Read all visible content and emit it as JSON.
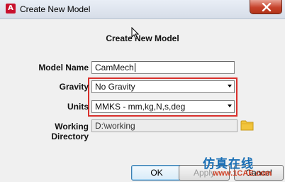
{
  "window": {
    "title": "Create New Model",
    "app_icon_letter": "A"
  },
  "dialog": {
    "heading": "Create New Model",
    "fields": {
      "model_name": {
        "label": "Model Name",
        "value": "CamMech"
      },
      "gravity": {
        "label": "Gravity",
        "value": "No Gravity"
      },
      "units": {
        "label": "Units",
        "value": "MMKS - mm,kg,N,s,deg"
      },
      "working_directory": {
        "label": "Working Directory",
        "value": "D:\\working"
      }
    },
    "buttons": {
      "ok": "OK",
      "apply": "Apply",
      "cancel": "Cancel"
    }
  },
  "watermark": {
    "center_text": "1CAE.COM",
    "corner_cn": "仿真在线",
    "corner_en": "www.1CAE.com"
  },
  "colors": {
    "highlight_border": "#d9302c",
    "close_button": "#c7432c",
    "app_icon": "#c8102e"
  },
  "icons": {
    "close": "close-icon",
    "folder": "folder-icon",
    "dropdown": "chevron-down-icon"
  }
}
